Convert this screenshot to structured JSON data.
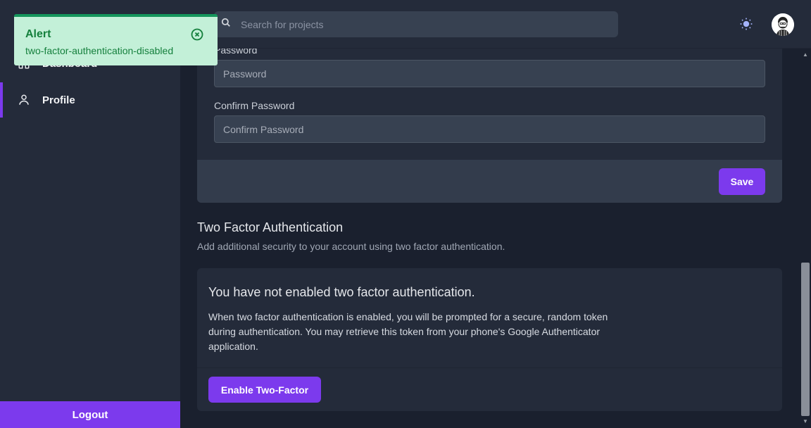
{
  "sidebar": {
    "items": [
      {
        "label": "Dashboard",
        "icon": "home-icon"
      },
      {
        "label": "Profile",
        "icon": "user-icon",
        "active": true
      }
    ],
    "logout_label": "Logout"
  },
  "header": {
    "search_placeholder": "Search for projects",
    "theme_icon": "sun-icon",
    "avatar_icon": "avatar"
  },
  "password_form": {
    "password_label": "Password",
    "password_placeholder": "Password",
    "confirm_label": "Confirm Password",
    "confirm_placeholder": "Confirm Password",
    "save_label": "Save"
  },
  "two_factor": {
    "title": "Two Factor Authentication",
    "description": "Add additional security to your account using two factor authentication.",
    "status_heading": "You have not enabled two factor authentication.",
    "info_text": "When two factor authentication is enabled, you will be prompted for a secure, random token during authentication. You may retrieve this token from your phone's Google Authenticator application.",
    "enable_label": "Enable Two-Factor"
  },
  "toast": {
    "title": "Alert",
    "message": "two-factor-authentication-disabled"
  },
  "colors": {
    "accent": "#7c3aed",
    "background": "#1a202e",
    "panel": "#242b3a",
    "toast_bg": "#c3f0d8",
    "toast_text": "#15803d"
  }
}
